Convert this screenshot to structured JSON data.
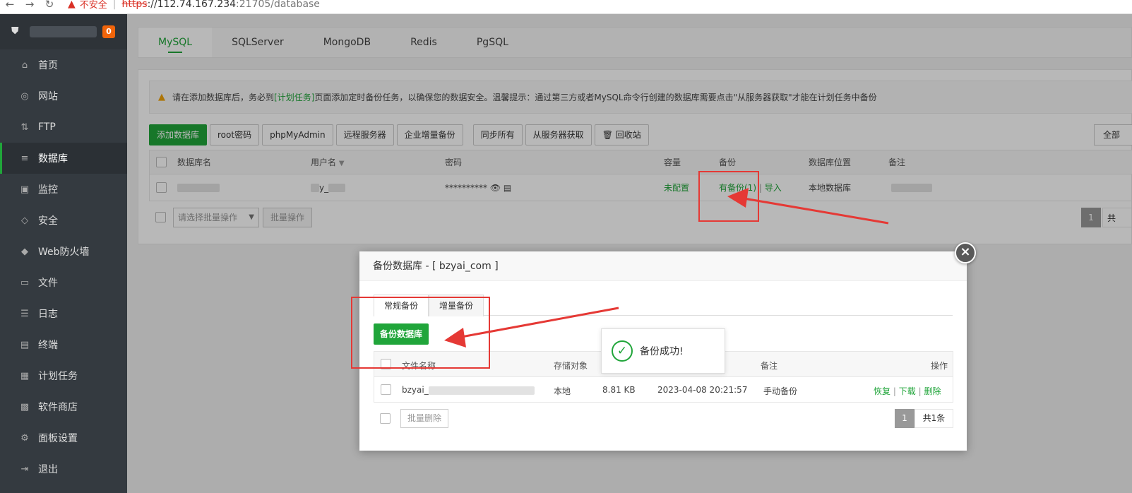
{
  "browser": {
    "insecure_label": "不安全",
    "url_scheme": "https",
    "url_host": "://112.74.167.234",
    "url_rest": ":21705/database"
  },
  "sidebar": {
    "badge": "0",
    "items": [
      {
        "label": "首页",
        "icon": "home-icon",
        "glyph": "⌂"
      },
      {
        "label": "网站",
        "icon": "globe-icon",
        "glyph": "◎"
      },
      {
        "label": "FTP",
        "icon": "ftp-icon",
        "glyph": "⇅"
      },
      {
        "label": "数据库",
        "icon": "database-icon",
        "glyph": "≡"
      },
      {
        "label": "监控",
        "icon": "monitor-icon",
        "glyph": "▣"
      },
      {
        "label": "安全",
        "icon": "shield-icon",
        "glyph": "◇"
      },
      {
        "label": "Web防火墙",
        "icon": "firewall-icon",
        "glyph": "◆"
      },
      {
        "label": "文件",
        "icon": "folder-icon",
        "glyph": "▭"
      },
      {
        "label": "日志",
        "icon": "log-icon",
        "glyph": "☰"
      },
      {
        "label": "终端",
        "icon": "terminal-icon",
        "glyph": "▤"
      },
      {
        "label": "计划任务",
        "icon": "calendar-icon",
        "glyph": "▦"
      },
      {
        "label": "软件商店",
        "icon": "apps-icon",
        "glyph": "▩"
      },
      {
        "label": "面板设置",
        "icon": "gear-icon",
        "glyph": "⚙"
      },
      {
        "label": "退出",
        "icon": "logout-icon",
        "glyph": "⇥"
      }
    ],
    "active_index": 3
  },
  "db_tabs": [
    "MySQL",
    "SQLServer",
    "MongoDB",
    "Redis",
    "PgSQL"
  ],
  "alert": {
    "before": "请在添加数据库后，务必到",
    "link": "[计划任务]",
    "after": "页面添加定时备份任务，以确保您的数据安全。温馨提示：通过第三方或者MySQL命令行创建的数据库需要点击\"从服务器获取\"才能在计划任务中备份"
  },
  "toolbar": {
    "buttons": [
      "添加数据库",
      "root密码",
      "phpMyAdmin",
      "远程服务器",
      "企业增量备份"
    ],
    "buttons2": [
      "同步所有",
      "从服务器获取",
      "回收站"
    ],
    "filter": "全部"
  },
  "table": {
    "headers": [
      "数据库名",
      "用户名",
      "密码",
      "容量",
      "备份",
      "数据库位置",
      "备注"
    ],
    "row": {
      "user_visible": "y_",
      "password": "**********",
      "capacity": "未配置",
      "backup": "有备份(1)",
      "import": "导入",
      "location": "本地数据库"
    },
    "batch_placeholder": "请选择批量操作",
    "batch_button": "批量操作",
    "page": "1",
    "total_partial": "共"
  },
  "modal": {
    "title": "备份数据库 - [ bzyai_com ]",
    "tabs": [
      "常规备份",
      "增量备份"
    ],
    "backup_button": "备份数据库",
    "headers": [
      "文件名称",
      "存储对象",
      "备注",
      "操作"
    ],
    "row": {
      "filename": "bzyai_",
      "storage": "本地",
      "size": "8.81 KB",
      "time": "2023-04-08 20:21:57",
      "note": "手动备份",
      "actions": [
        "恢复",
        "下载",
        "删除"
      ]
    },
    "batch_delete": "批量删除",
    "page": "1",
    "total": "共1条"
  },
  "toast": {
    "message": "备份成功!"
  },
  "colors": {
    "accent": "#20a53a",
    "sidebar_bg": "#343a40",
    "annotation_red": "#e53935"
  }
}
